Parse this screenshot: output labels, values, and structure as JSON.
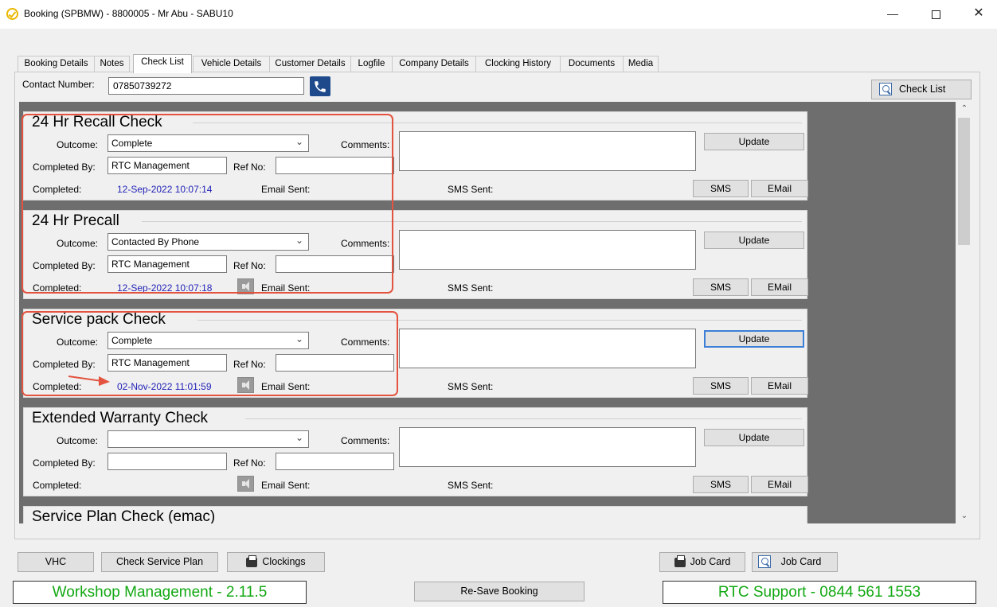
{
  "window": {
    "title": "Booking (SPBMW) - 8800005 - Mr Abu - SABU10"
  },
  "tabs": [
    "Booking Details",
    "Notes",
    "Check List",
    "Vehicle Details",
    "Customer Details",
    "Logfile",
    "Company Details",
    "Clocking History",
    "Documents",
    "Media"
  ],
  "active_tab": "Check List",
  "contact": {
    "label": "Contact Number:",
    "value": "07850739272"
  },
  "check_list_button": "Check List",
  "labels": {
    "outcome": "Outcome:",
    "comments": "Comments:",
    "completed_by": "Completed By:",
    "ref_no": "Ref No:",
    "completed": "Completed:",
    "email_sent": "Email Sent:",
    "sms_sent": "SMS Sent:",
    "update": "Update",
    "sms": "SMS",
    "email": "EMail"
  },
  "sections": [
    {
      "title": "24 Hr Recall Check",
      "outcome": "Complete",
      "completed_by": "RTC Management",
      "completed": "12-Sep-2022 10:07:14"
    },
    {
      "title": "24 Hr Precall",
      "outcome": "Contacted By Phone",
      "completed_by": "RTC Management",
      "completed": "12-Sep-2022 10:07:18"
    },
    {
      "title": "Service pack Check",
      "outcome": "Complete",
      "completed_by": "RTC Management",
      "completed": "02-Nov-2022 11:01:59"
    },
    {
      "title": "Extended Warranty Check",
      "outcome": "",
      "completed_by": "",
      "completed": ""
    },
    {
      "title": "Service Plan Check (emac)"
    }
  ],
  "bottom": {
    "vhc": "VHC",
    "check_service_plan": "Check Service Plan",
    "clockings": "Clockings",
    "job_card_print": "Job Card",
    "job_card_preview": "Job Card",
    "resave": "Re-Save Booking",
    "version": "Workshop Management - 2.11.5",
    "support": "RTC Support - 0844 561 1553"
  }
}
